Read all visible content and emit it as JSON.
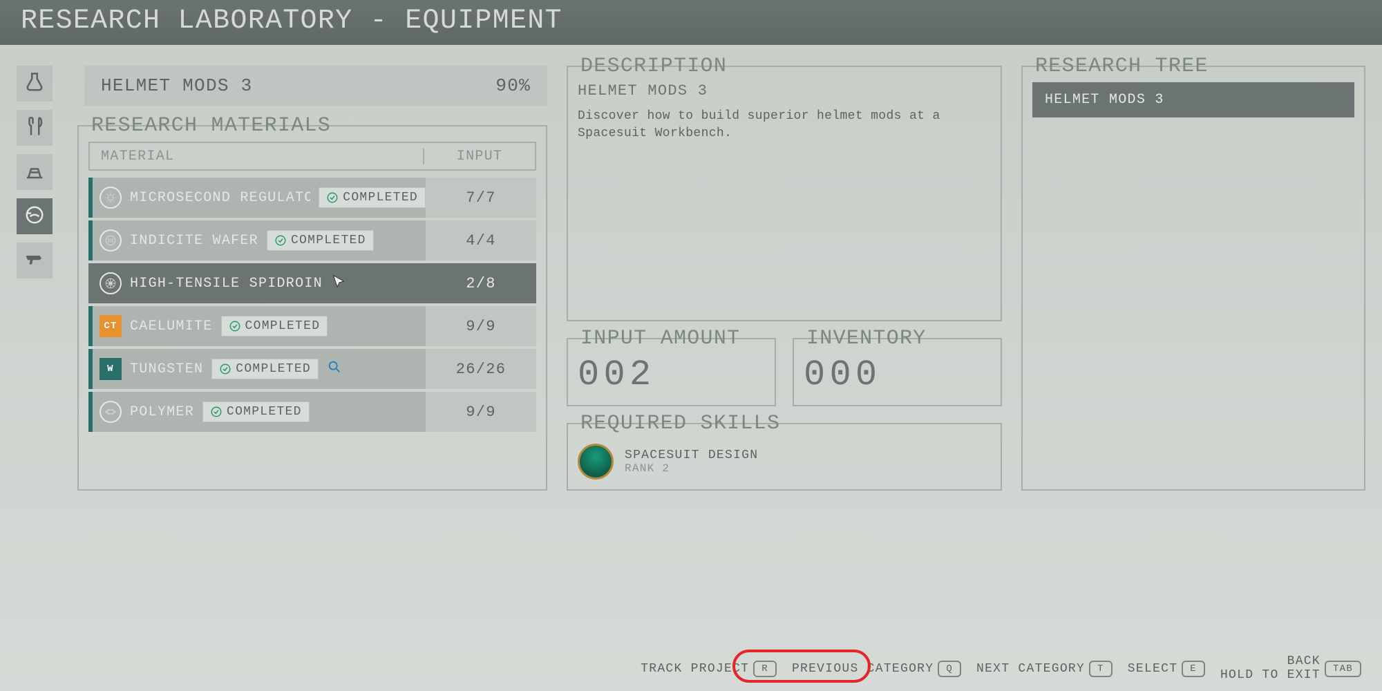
{
  "header": {
    "title": "RESEARCH LABORATORY - EQUIPMENT"
  },
  "project": {
    "name": "HELMET MODS 3",
    "progress": "90%"
  },
  "materials": {
    "legend": "RESEARCH MATERIALS",
    "col_material": "MATERIAL",
    "col_input": "INPUT",
    "completed_label": "COMPLETED",
    "rows": [
      {
        "name": "MICROSECOND REGULATOR",
        "input": "7/7",
        "status": "completed",
        "icon": "circle-sun"
      },
      {
        "name": "INDICITE WAFER",
        "input": "4/4",
        "status": "completed",
        "icon": "circle-bars"
      },
      {
        "name": "HIGH-TENSILE SPIDROIN",
        "input": "2/8",
        "status": "selected",
        "icon": "wheel"
      },
      {
        "name": "CAELUMITE",
        "input": "9/9",
        "status": "completed",
        "icon": "CT",
        "iconType": "square",
        "iconColor": "orange"
      },
      {
        "name": "TUNGSTEN",
        "input": "26/26",
        "status": "completed",
        "icon": "W",
        "iconType": "square",
        "iconColor": "teal",
        "tagged": true
      },
      {
        "name": "POLYMER",
        "input": "9/9",
        "status": "completed",
        "icon": "bug"
      }
    ]
  },
  "description": {
    "legend": "DESCRIPTION",
    "title": "HELMET MODS 3",
    "body": "Discover how to build superior helmet mods at a Spacesuit Workbench."
  },
  "input_amount": {
    "legend": "INPUT AMOUNT",
    "value": "002"
  },
  "inventory": {
    "legend": "INVENTORY",
    "value": "000"
  },
  "skills": {
    "legend": "REQUIRED SKILLS",
    "name": "SPACESUIT DESIGN",
    "rank": "RANK 2"
  },
  "tree": {
    "legend": "RESEARCH TREE",
    "item": "HELMET MODS 3"
  },
  "footer": {
    "track": "TRACK PROJECT",
    "track_key": "R",
    "prev": "PREVIOUS CATEGORY",
    "prev_key": "Q",
    "next": "NEXT CATEGORY",
    "next_key": "T",
    "select": "SELECT",
    "select_key": "E",
    "back": "BACK",
    "exit": "HOLD TO EXIT",
    "exit_key": "TAB"
  },
  "categories": [
    "pharmacology",
    "food",
    "outpost",
    "equipment",
    "weaponry"
  ]
}
